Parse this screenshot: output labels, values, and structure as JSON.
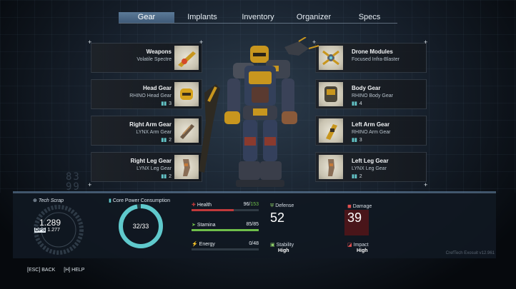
{
  "tabs": [
    {
      "label": "Gear",
      "active": true
    },
    {
      "label": "Implants",
      "active": false
    },
    {
      "label": "Inventory",
      "active": false
    },
    {
      "label": "Organizer",
      "active": false
    },
    {
      "label": "Specs",
      "active": false
    }
  ],
  "gear_left": [
    {
      "name": "Weapons",
      "item": "Volatile Spectre",
      "level": ""
    },
    {
      "name": "Head Gear",
      "item": "RHINO Head Gear",
      "level": "3"
    },
    {
      "name": "Right Arm Gear",
      "item": "LYNX Arm Gear",
      "level": "2"
    },
    {
      "name": "Right Leg Gear",
      "item": "LYNX Leg Gear",
      "level": "2"
    }
  ],
  "gear_right": [
    {
      "name": "Drone Modules",
      "item": "Focused Infra-Blaster",
      "level": ""
    },
    {
      "name": "Body Gear",
      "item": "RHINO Body Gear",
      "level": "4"
    },
    {
      "name": "Left Arm Gear",
      "item": "RHINO Arm Gear",
      "level": "3"
    },
    {
      "name": "Left Leg Gear",
      "item": "LYNX Leg Gear",
      "level": "2"
    }
  ],
  "tech_scrap": {
    "label": "Tech Scrap",
    "value": "1.289",
    "dps_label": "DPS",
    "dps_value": "1.277"
  },
  "core_power": {
    "label": "Core Power Consumption",
    "value": "32/33",
    "fraction": 0.97
  },
  "health": {
    "label": "Health",
    "current": "96",
    "max": "153",
    "fraction": 0.63,
    "color": "#c0393b"
  },
  "stamina": {
    "label": "Stamina",
    "value": "85/85",
    "fraction": 1.0,
    "color": "#6fbf4a"
  },
  "energy": {
    "label": "Energy",
    "value": "0/48",
    "fraction": 0.0,
    "color": "#3d8fd0"
  },
  "defense": {
    "label": "Defense",
    "value": "52",
    "stability_label": "Stability",
    "stability_value": "High"
  },
  "damage": {
    "label": "Damage",
    "value": "39",
    "impact_label": "Impact",
    "impact_value": "High"
  },
  "footer": {
    "back": "[ESC] BACK",
    "help": "[H] HELP"
  },
  "credit": "CrefTech Exosuit v12.961",
  "deco_numbers": [
    "83",
    "99"
  ],
  "colors": {
    "accent_cyan": "#5fc9cc",
    "tab_active": "#4e6d8c",
    "health_red": "#c0393b"
  }
}
